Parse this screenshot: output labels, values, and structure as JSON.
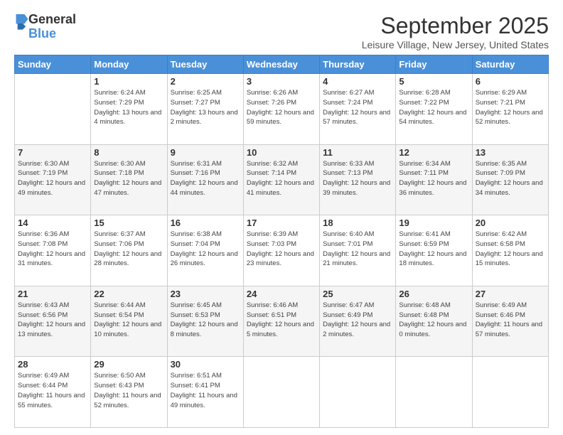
{
  "logo": {
    "general": "General",
    "blue": "Blue"
  },
  "title": "September 2025",
  "location": "Leisure Village, New Jersey, United States",
  "days_of_week": [
    "Sunday",
    "Monday",
    "Tuesday",
    "Wednesday",
    "Thursday",
    "Friday",
    "Saturday"
  ],
  "weeks": [
    [
      {
        "num": "",
        "sunrise": "",
        "sunset": "",
        "daylight": ""
      },
      {
        "num": "1",
        "sunrise": "Sunrise: 6:24 AM",
        "sunset": "Sunset: 7:29 PM",
        "daylight": "Daylight: 13 hours and 4 minutes."
      },
      {
        "num": "2",
        "sunrise": "Sunrise: 6:25 AM",
        "sunset": "Sunset: 7:27 PM",
        "daylight": "Daylight: 13 hours and 2 minutes."
      },
      {
        "num": "3",
        "sunrise": "Sunrise: 6:26 AM",
        "sunset": "Sunset: 7:26 PM",
        "daylight": "Daylight: 12 hours and 59 minutes."
      },
      {
        "num": "4",
        "sunrise": "Sunrise: 6:27 AM",
        "sunset": "Sunset: 7:24 PM",
        "daylight": "Daylight: 12 hours and 57 minutes."
      },
      {
        "num": "5",
        "sunrise": "Sunrise: 6:28 AM",
        "sunset": "Sunset: 7:22 PM",
        "daylight": "Daylight: 12 hours and 54 minutes."
      },
      {
        "num": "6",
        "sunrise": "Sunrise: 6:29 AM",
        "sunset": "Sunset: 7:21 PM",
        "daylight": "Daylight: 12 hours and 52 minutes."
      }
    ],
    [
      {
        "num": "7",
        "sunrise": "Sunrise: 6:30 AM",
        "sunset": "Sunset: 7:19 PM",
        "daylight": "Daylight: 12 hours and 49 minutes."
      },
      {
        "num": "8",
        "sunrise": "Sunrise: 6:30 AM",
        "sunset": "Sunset: 7:18 PM",
        "daylight": "Daylight: 12 hours and 47 minutes."
      },
      {
        "num": "9",
        "sunrise": "Sunrise: 6:31 AM",
        "sunset": "Sunset: 7:16 PM",
        "daylight": "Daylight: 12 hours and 44 minutes."
      },
      {
        "num": "10",
        "sunrise": "Sunrise: 6:32 AM",
        "sunset": "Sunset: 7:14 PM",
        "daylight": "Daylight: 12 hours and 41 minutes."
      },
      {
        "num": "11",
        "sunrise": "Sunrise: 6:33 AM",
        "sunset": "Sunset: 7:13 PM",
        "daylight": "Daylight: 12 hours and 39 minutes."
      },
      {
        "num": "12",
        "sunrise": "Sunrise: 6:34 AM",
        "sunset": "Sunset: 7:11 PM",
        "daylight": "Daylight: 12 hours and 36 minutes."
      },
      {
        "num": "13",
        "sunrise": "Sunrise: 6:35 AM",
        "sunset": "Sunset: 7:09 PM",
        "daylight": "Daylight: 12 hours and 34 minutes."
      }
    ],
    [
      {
        "num": "14",
        "sunrise": "Sunrise: 6:36 AM",
        "sunset": "Sunset: 7:08 PM",
        "daylight": "Daylight: 12 hours and 31 minutes."
      },
      {
        "num": "15",
        "sunrise": "Sunrise: 6:37 AM",
        "sunset": "Sunset: 7:06 PM",
        "daylight": "Daylight: 12 hours and 28 minutes."
      },
      {
        "num": "16",
        "sunrise": "Sunrise: 6:38 AM",
        "sunset": "Sunset: 7:04 PM",
        "daylight": "Daylight: 12 hours and 26 minutes."
      },
      {
        "num": "17",
        "sunrise": "Sunrise: 6:39 AM",
        "sunset": "Sunset: 7:03 PM",
        "daylight": "Daylight: 12 hours and 23 minutes."
      },
      {
        "num": "18",
        "sunrise": "Sunrise: 6:40 AM",
        "sunset": "Sunset: 7:01 PM",
        "daylight": "Daylight: 12 hours and 21 minutes."
      },
      {
        "num": "19",
        "sunrise": "Sunrise: 6:41 AM",
        "sunset": "Sunset: 6:59 PM",
        "daylight": "Daylight: 12 hours and 18 minutes."
      },
      {
        "num": "20",
        "sunrise": "Sunrise: 6:42 AM",
        "sunset": "Sunset: 6:58 PM",
        "daylight": "Daylight: 12 hours and 15 minutes."
      }
    ],
    [
      {
        "num": "21",
        "sunrise": "Sunrise: 6:43 AM",
        "sunset": "Sunset: 6:56 PM",
        "daylight": "Daylight: 12 hours and 13 minutes."
      },
      {
        "num": "22",
        "sunrise": "Sunrise: 6:44 AM",
        "sunset": "Sunset: 6:54 PM",
        "daylight": "Daylight: 12 hours and 10 minutes."
      },
      {
        "num": "23",
        "sunrise": "Sunrise: 6:45 AM",
        "sunset": "Sunset: 6:53 PM",
        "daylight": "Daylight: 12 hours and 8 minutes."
      },
      {
        "num": "24",
        "sunrise": "Sunrise: 6:46 AM",
        "sunset": "Sunset: 6:51 PM",
        "daylight": "Daylight: 12 hours and 5 minutes."
      },
      {
        "num": "25",
        "sunrise": "Sunrise: 6:47 AM",
        "sunset": "Sunset: 6:49 PM",
        "daylight": "Daylight: 12 hours and 2 minutes."
      },
      {
        "num": "26",
        "sunrise": "Sunrise: 6:48 AM",
        "sunset": "Sunset: 6:48 PM",
        "daylight": "Daylight: 12 hours and 0 minutes."
      },
      {
        "num": "27",
        "sunrise": "Sunrise: 6:49 AM",
        "sunset": "Sunset: 6:46 PM",
        "daylight": "Daylight: 11 hours and 57 minutes."
      }
    ],
    [
      {
        "num": "28",
        "sunrise": "Sunrise: 6:49 AM",
        "sunset": "Sunset: 6:44 PM",
        "daylight": "Daylight: 11 hours and 55 minutes."
      },
      {
        "num": "29",
        "sunrise": "Sunrise: 6:50 AM",
        "sunset": "Sunset: 6:43 PM",
        "daylight": "Daylight: 11 hours and 52 minutes."
      },
      {
        "num": "30",
        "sunrise": "Sunrise: 6:51 AM",
        "sunset": "Sunset: 6:41 PM",
        "daylight": "Daylight: 11 hours and 49 minutes."
      },
      {
        "num": "",
        "sunrise": "",
        "sunset": "",
        "daylight": ""
      },
      {
        "num": "",
        "sunrise": "",
        "sunset": "",
        "daylight": ""
      },
      {
        "num": "",
        "sunrise": "",
        "sunset": "",
        "daylight": ""
      },
      {
        "num": "",
        "sunrise": "",
        "sunset": "",
        "daylight": ""
      }
    ]
  ]
}
